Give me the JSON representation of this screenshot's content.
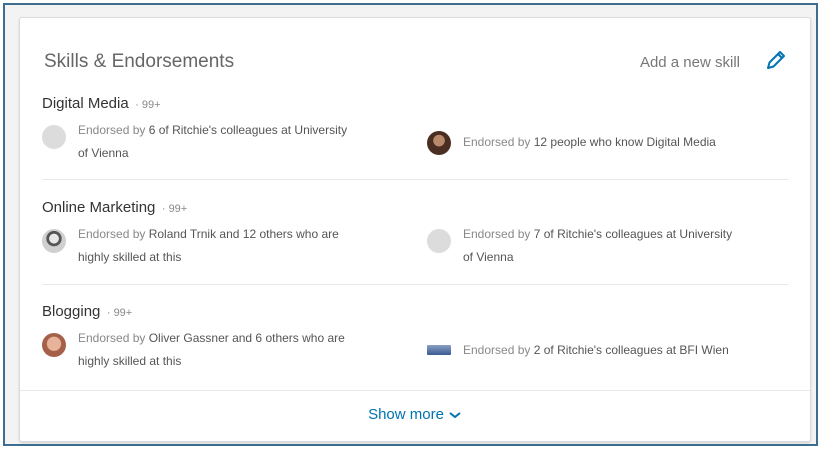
{
  "section": {
    "title": "Skills & Endorsements",
    "add_skill_label": "Add a new skill",
    "edit_icon": "pencil-icon"
  },
  "skills": [
    {
      "name": "Digital Media",
      "count": "· 99+",
      "endorsements": [
        {
          "prefix": "Endorsed by ",
          "strong": "6 of Ritchie's colleagues at University",
          "rest": "of Vienna",
          "avatar": "avatar-placeholder"
        },
        {
          "prefix": "Endorsed by ",
          "strong": "12 people who know Digital Media",
          "rest": "",
          "avatar": "avatar-photo"
        }
      ]
    },
    {
      "name": "Online Marketing",
      "count": "· 99+",
      "endorsements": [
        {
          "prefix": "Endorsed by ",
          "strong": "Roland Trnik and 12 others who are",
          "rest": "highly skilled at this",
          "avatar": "avatar-photo"
        },
        {
          "prefix": "Endorsed by ",
          "strong": "7 of Ritchie's colleagues at University",
          "rest": "of Vienna",
          "avatar": "avatar-placeholder"
        }
      ]
    },
    {
      "name": "Blogging",
      "count": "· 99+",
      "endorsements": [
        {
          "prefix": "Endorsed by ",
          "strong": "Oliver Gassner and 6 others who are",
          "rest": "highly skilled at this",
          "avatar": "avatar-photo"
        },
        {
          "prefix": "Endorsed by ",
          "strong": "2 of Ritchie's colleagues at BFI Wien",
          "rest": "",
          "avatar": "company-logo"
        }
      ]
    }
  ],
  "footer": {
    "show_more_label": "Show more",
    "icon": "chevron-down-icon"
  },
  "colors": {
    "link": "#0073b1",
    "frame_border": "#3d6e92"
  }
}
